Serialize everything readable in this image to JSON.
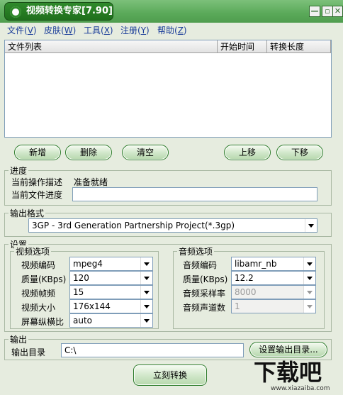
{
  "window": {
    "title": "视频转换专家[7.90]",
    "min_label": "—",
    "max_label": "▫",
    "close_label": "✕"
  },
  "menu": [
    {
      "label": "文件(",
      "key": "V",
      "end": ")"
    },
    {
      "label": "皮肤(",
      "key": "W",
      "end": ")"
    },
    {
      "label": "工具(",
      "key": "X",
      "end": ")"
    },
    {
      "label": "注册(",
      "key": "Y",
      "end": ")"
    },
    {
      "label": "帮助(",
      "key": "Z",
      "end": ")"
    }
  ],
  "filelist": {
    "columns": [
      "文件列表",
      "开始时间",
      "转换长度"
    ]
  },
  "actions": {
    "add": "新增",
    "delete": "删除",
    "clear": "清空",
    "up": "上移",
    "down": "下移"
  },
  "progress": {
    "legend": "进度",
    "op_label": "当前操作描述",
    "op_value": "准备就绪",
    "file_label": "当前文件进度",
    "file_value": ""
  },
  "format": {
    "legend": "输出格式",
    "selected": "3GP - 3rd Generation Partnership Project(*.3gp)"
  },
  "settings": {
    "legend": "设置",
    "video": {
      "legend": "视频选项",
      "codec_label": "视频编码",
      "codec": "mpeg4",
      "quality_label": "质量(KBps)",
      "quality": "120",
      "fps_label": "视频帧频",
      "fps": "15",
      "size_label": "视频大小",
      "size": "176x144",
      "aspect_label": "屏幕纵横比",
      "aspect": "auto"
    },
    "audio": {
      "legend": "音频选项",
      "codec_label": "音频编码",
      "codec": "libamr_nb",
      "quality_label": "质量(KBps)",
      "quality": "12.2",
      "rate_label": "音频采样率",
      "rate": "8000",
      "channels_label": "音频声道数",
      "channels": "1"
    }
  },
  "output": {
    "legend": "输出",
    "dir_label": "输出目录",
    "dir_value": "C:\\",
    "set_dir_button": "设置输出目录..."
  },
  "convert_button": "立刻转换",
  "watermark": {
    "text": "下载吧",
    "url": "www.xiazaiba.com"
  },
  "colors": {
    "title_green": "#2f8a2b",
    "menu_blue": "#1a3d99",
    "button_border": "#2d7c2a"
  }
}
